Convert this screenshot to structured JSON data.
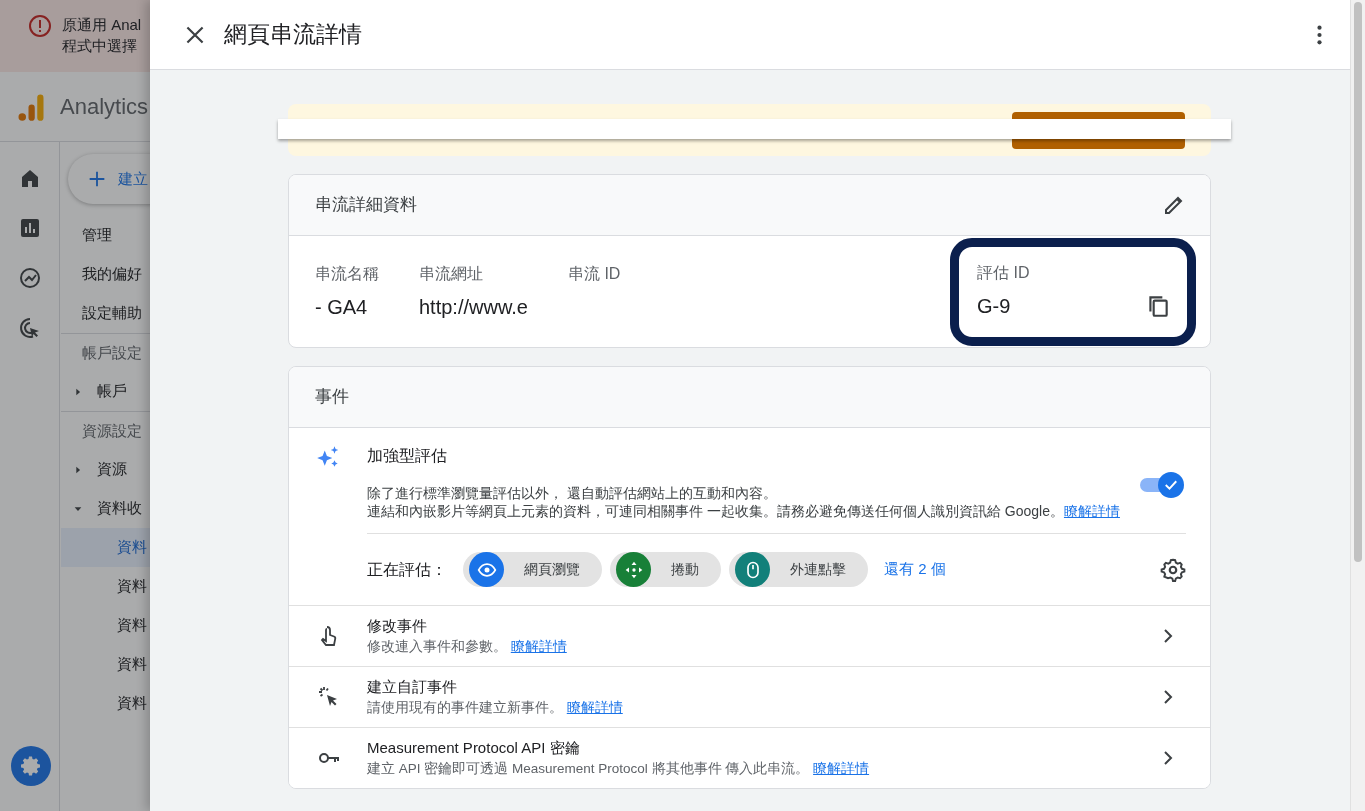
{
  "background_app": {
    "alert": {
      "lines": [
        "原通用 Anal",
        "程式中選擇"
      ]
    },
    "product": "Analytics",
    "create_button": "建立",
    "nav": [
      {
        "label": "管理",
        "kind": "item"
      },
      {
        "label": "我的偏好",
        "kind": "item"
      },
      {
        "label": "設定輔助",
        "kind": "item"
      },
      {
        "label": "帳戶設定",
        "kind": "section"
      },
      {
        "label": "帳戶",
        "kind": "tree",
        "expanded": false
      },
      {
        "label": "資源設定",
        "kind": "section"
      },
      {
        "label": "資源",
        "kind": "tree",
        "expanded": false
      },
      {
        "label": "資料收",
        "kind": "tree",
        "expanded": true
      },
      {
        "label": "資料",
        "kind": "sub",
        "selected": true
      },
      {
        "label": "資料",
        "kind": "sub",
        "selected": false
      },
      {
        "label": "資料",
        "kind": "sub",
        "selected": false
      },
      {
        "label": "資料",
        "kind": "sub",
        "selected": false
      },
      {
        "label": "資料",
        "kind": "sub",
        "selected": false
      }
    ]
  },
  "panel": {
    "title": "網頁串流詳情",
    "details": {
      "title": "串流詳細資料",
      "fields": [
        {
          "label": "串流名稱",
          "value": "- GA4",
          "highlighted": false
        },
        {
          "label": "串流網址",
          "value": "http://www.e",
          "highlighted": false
        },
        {
          "label": "串流 ID",
          "highlighted": false
        },
        {
          "label": "評估 ID",
          "value": "G-9",
          "highlighted": true
        }
      ]
    },
    "events": {
      "title": "事件",
      "enhanced": {
        "title": "加強型評估",
        "on": true,
        "description_lines": [
          "除了進行標準瀏覽量評估以外， 還自動評估網站上的互動和內容。",
          "連結和內嵌影片等網頁上元素的資料，可連同相關事件 一起收集。請務必避免傳送任何個人識別資訊給 Google。"
        ],
        "link": "瞭解詳情",
        "measuring_label": "正在評估：",
        "chips": [
          {
            "label": "網頁瀏覽",
            "color": "#1a73e8",
            "kind": "eye"
          },
          {
            "label": "捲動",
            "color": "#188038",
            "kind": "move"
          },
          {
            "label": "外連點擊",
            "color": "#12807a",
            "kind": "mouse"
          }
        ],
        "more": "還有 2 個"
      },
      "rows": [
        {
          "kind": "touch",
          "title": "修改事件",
          "description": "修改連入事件和參數。",
          "link": "瞭解詳情"
        },
        {
          "kind": "click",
          "title": "建立自訂事件",
          "description": "請使用現有的事件建立新事件。",
          "link": "瞭解詳情"
        },
        {
          "kind": "key",
          "title": "Measurement Protocol API 密鑰",
          "description": "建立 API 密鑰即可透過 Measurement Protocol 將其他事件 傳入此串流。",
          "link": "瞭解詳情"
        }
      ]
    }
  }
}
